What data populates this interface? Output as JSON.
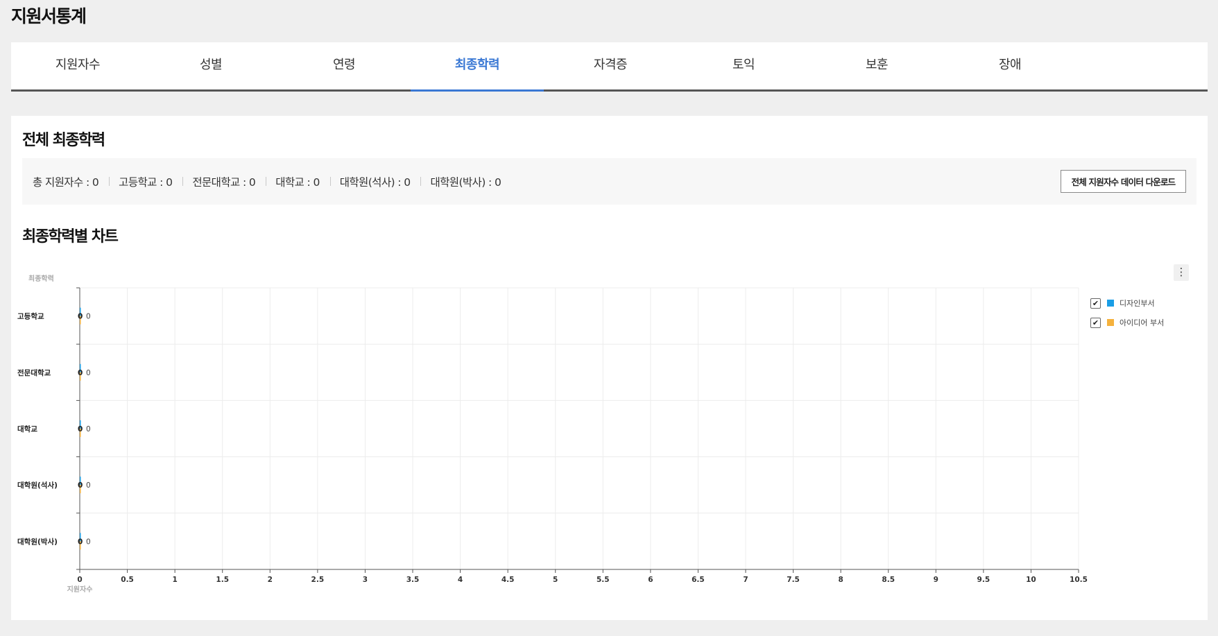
{
  "page": {
    "title": "지원서통계"
  },
  "tabs": [
    {
      "label": "지원자수",
      "active": false
    },
    {
      "label": "성별",
      "active": false
    },
    {
      "label": "연령",
      "active": false
    },
    {
      "label": "최종학력",
      "active": true
    },
    {
      "label": "자격증",
      "active": false
    },
    {
      "label": "토익",
      "active": false
    },
    {
      "label": "보훈",
      "active": false
    },
    {
      "label": "장애",
      "active": false
    }
  ],
  "summary": {
    "title": "전체 최종학력",
    "items": [
      "총 지원자수 : 0",
      "고등학교 : 0",
      "전문대학교 : 0",
      "대학교 : 0",
      "대학원(석사) : 0",
      "대학원(박사) : 0"
    ],
    "download_label": "전체 지원자수 데이터 다운로드"
  },
  "chart_section": {
    "title": "최종학력별 차트",
    "menu_glyph": "⋮"
  },
  "legend": [
    {
      "name": "디자인부서",
      "color": "#1a9ee6",
      "checked": true,
      "check_glyph": "✔"
    },
    {
      "name": "아이디어 부서",
      "color": "#f5b23d",
      "checked": true,
      "check_glyph": "✔"
    }
  ],
  "chart_data": {
    "type": "bar",
    "orientation": "horizontal",
    "ylabel": "최종학력",
    "xlabel": "지원자수",
    "categories": [
      "고등학교",
      "전문대학교",
      "대학교",
      "대학원(석사)",
      "대학원(박사)"
    ],
    "series": [
      {
        "name": "디자인부서",
        "values": [
          0,
          0,
          0,
          0,
          0
        ]
      },
      {
        "name": "아이디어 부서",
        "values": [
          0,
          0,
          0,
          0,
          0
        ]
      }
    ],
    "xlim": [
      0,
      10.5
    ],
    "xticks": [
      0,
      0.5,
      1,
      1.5,
      2,
      2.5,
      3,
      3.5,
      4,
      4.5,
      5,
      5.5,
      6,
      6.5,
      7,
      7.5,
      8,
      8.5,
      9,
      9.5,
      10,
      10.5
    ],
    "grid": true,
    "legend_position": "right"
  }
}
